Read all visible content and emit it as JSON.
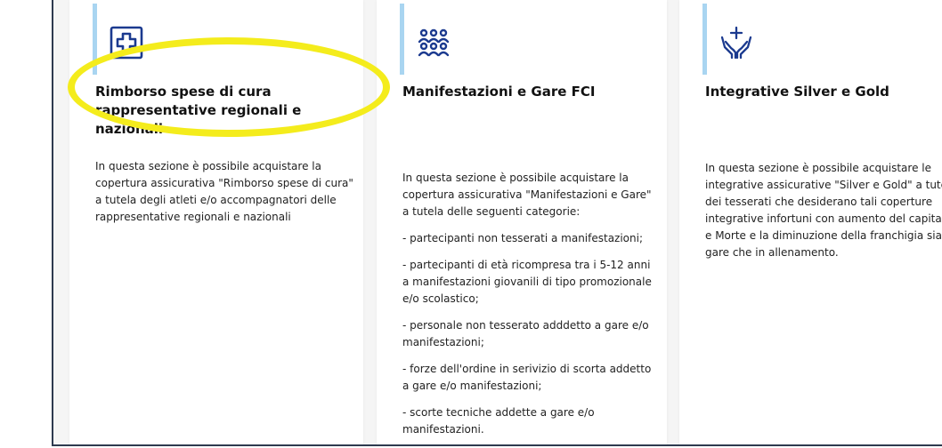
{
  "cards": [
    {
      "icon": "medical-cross-icon",
      "title": "Rimborso spese di cura rappresentative regionali e nazionali",
      "paragraphs": [
        "In questa sezione è possibile acquistare la copertura assicurativa \"Rimborso spese di cura\" a tutela degli atleti e/o accompagnatori delle rappresentative regionali e nazionali"
      ]
    },
    {
      "icon": "group-people-icon",
      "title": "Manifestazioni e Gare FCI",
      "paragraphs": [
        "In questa sezione è possibile acquistare la copertura assicurativa \"Manifestazioni e Gare\" a tutela delle seguenti categorie:",
        "- partecipanti non tesserati a manifestazioni;",
        "- partecipanti di età ricompresa tra i 5-12 anni a manifestazioni giovanili di tipo promozionale e/o scolastico;",
        "- personale non tesserato adddetto a gare e/o manifestazioni;",
        "- forze dell'ordine in serivizio di scorta addetto a gare e/o manifestazioni;",
        "- scorte tecniche addette a gare e/o manifestazioni."
      ]
    },
    {
      "icon": "hands-cross-icon",
      "title": "Integrative Silver e Gold",
      "paragraphs": [
        "In questa sezione è possibile acquistare le integrative assicurative \"Silver e Gold\" a tutela dei tesserati che desiderano tali coperture integrative infortuni con aumento del capitale IP e Morte e la diminuzione della franchigia sia in gare che in allenamento."
      ]
    }
  ],
  "colors": {
    "accent_bar": "#a9d5f1",
    "icon": "#1b3a8f",
    "highlight": "#f4ec1c"
  }
}
